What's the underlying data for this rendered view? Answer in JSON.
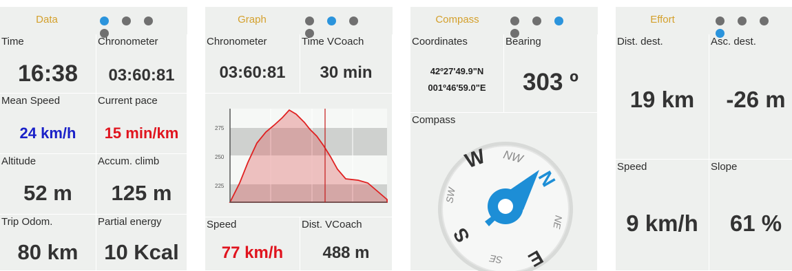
{
  "colors": {
    "title": "#d4a02c",
    "dot_active": "#2b94dc",
    "dot_inactive": "#707070",
    "speed_blue": "#1a21c8",
    "alert_red": "#e0141e",
    "value_dark": "#333333"
  },
  "screens": [
    {
      "title": "Data",
      "active_dot": 0,
      "fields": [
        {
          "label": "Time",
          "value": "16:38"
        },
        {
          "label": "Chronometer",
          "value": "03:60:81"
        },
        {
          "label": "Mean Speed",
          "value": "24 km/h"
        },
        {
          "label": "Current pace",
          "value": "15 min/km"
        },
        {
          "label": "Altitude",
          "value": "52 m"
        },
        {
          "label": "Accum. climb",
          "value": "125 m"
        },
        {
          "label": "Trip Odom.",
          "value": "80 km"
        },
        {
          "label": "Partial energy",
          "value": "10 Kcal"
        }
      ]
    },
    {
      "title": "Graph",
      "active_dot": 1,
      "fields": [
        {
          "label": "Chronometer",
          "value": "03:60:81"
        },
        {
          "label": "Time VCoach",
          "value": "30 min"
        },
        {
          "label": "Speed",
          "value": "77 km/h"
        },
        {
          "label": "Dist. VCoach",
          "value": "488 m"
        }
      ],
      "graph_ticks": [
        "275",
        "250",
        "225"
      ]
    },
    {
      "title": "Compass",
      "active_dot": 2,
      "fields": [
        {
          "label": "Coordinates",
          "value_lat": "42º27'49.9\"N",
          "value_lon": "001º46'59.0\"E"
        },
        {
          "label": "Bearing",
          "value": "303 º"
        },
        {
          "label": "Compass"
        }
      ],
      "compass_labels": [
        "W",
        "NW",
        "N",
        "NE",
        "E",
        "SE",
        "S",
        "SW"
      ]
    },
    {
      "title": "Effort",
      "active_dot": 3,
      "fields": [
        {
          "label": "Dist. dest.",
          "value": "19 km"
        },
        {
          "label": "Asc. dest.",
          "value": "-26 m"
        },
        {
          "label": "Speed",
          "value": "9 km/h"
        },
        {
          "label": "Slope",
          "value": "61 %"
        }
      ]
    }
  ]
}
